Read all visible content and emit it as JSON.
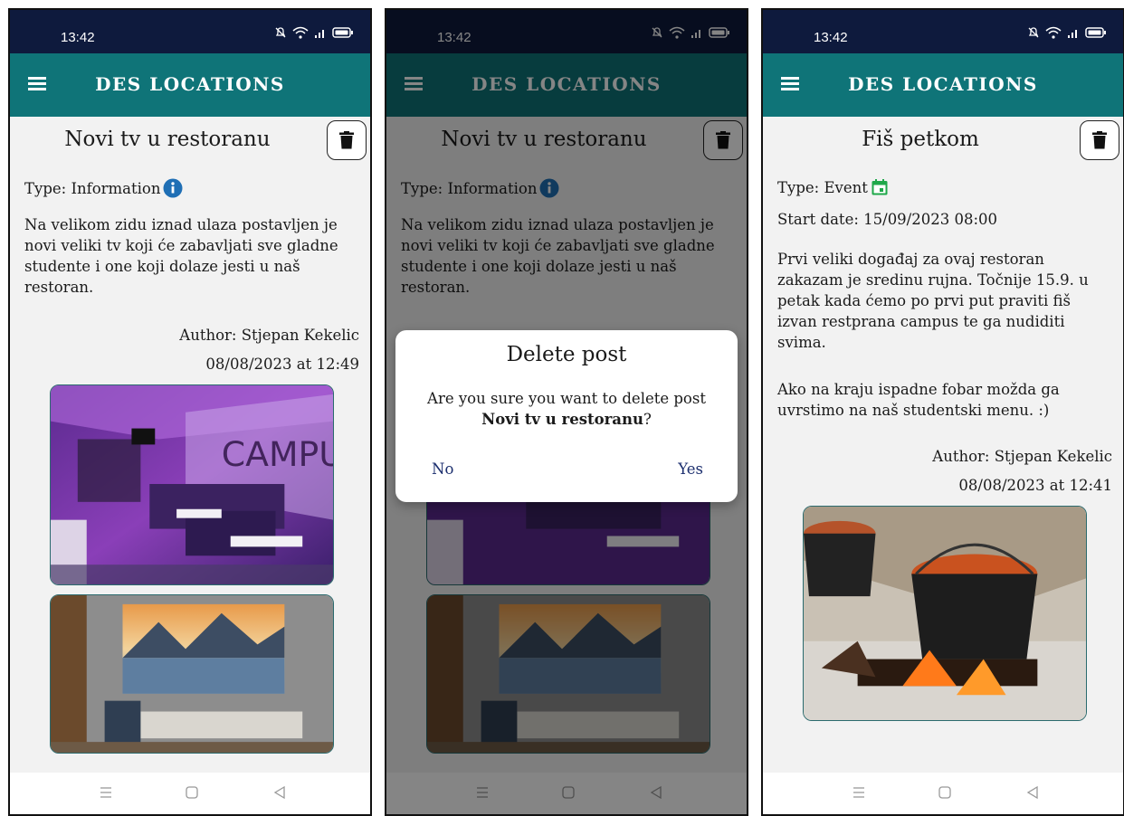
{
  "status": {
    "time": "13:42"
  },
  "app": {
    "title": "DES LOCATIONS"
  },
  "screen1": {
    "post_title": "Novi tv u restoranu",
    "type_text": "Type: Information",
    "body": "Na velikom zidu iznad ulaza postavljen je novi veliki tv koji će zabavljati sve gladne studente i one koji dolaze jesti u naš restoran.",
    "author": "Author: Stjepan Kekelic",
    "date": "08/08/2023 at 12:49"
  },
  "screen2": {
    "post_title": "Novi tv u restoranu",
    "type_text": "Type: Information",
    "body": "Na velikom zidu iznad ulaza postavljen je novi veliki tv koji će zabavljati sve gladne studente i one koji dolaze jesti u naš restoran.",
    "dialog": {
      "title": "Delete post",
      "message": "Are you sure you want to delete post",
      "post_name": "Novi tv u restoranu",
      "suffix": "?",
      "no_label": "No",
      "yes_label": "Yes"
    }
  },
  "screen3": {
    "post_title": "Fiš petkom",
    "type_text": "Type: Event",
    "start_date": "Start date: 15/09/2023 08:00",
    "body_p1": "Prvi veliki događaj za ovaj restoran zakazam je sredinu rujna. Točnije 15.9. u petak kada ćemo po prvi put praviti fiš izvan restprana campus te ga nudiditi svima.",
    "body_p2": "Ako na kraju ispadne fobar možda ga uvrstimo na naš studentski menu. :)",
    "author": "Author: Stjepan Kekelic",
    "date": "08/08/2023 at 12:41"
  },
  "colors": {
    "status_bar": "#0e1a3d",
    "app_bar": "#0f7478",
    "info_icon": "#1f6fb5",
    "event_icon": "#1fa84a",
    "dialog_button": "#1b2e6e"
  },
  "icons": {
    "menu": "hamburger-menu-icon",
    "delete": "trash-icon",
    "info": "info-circle-icon",
    "event": "calendar-icon"
  }
}
